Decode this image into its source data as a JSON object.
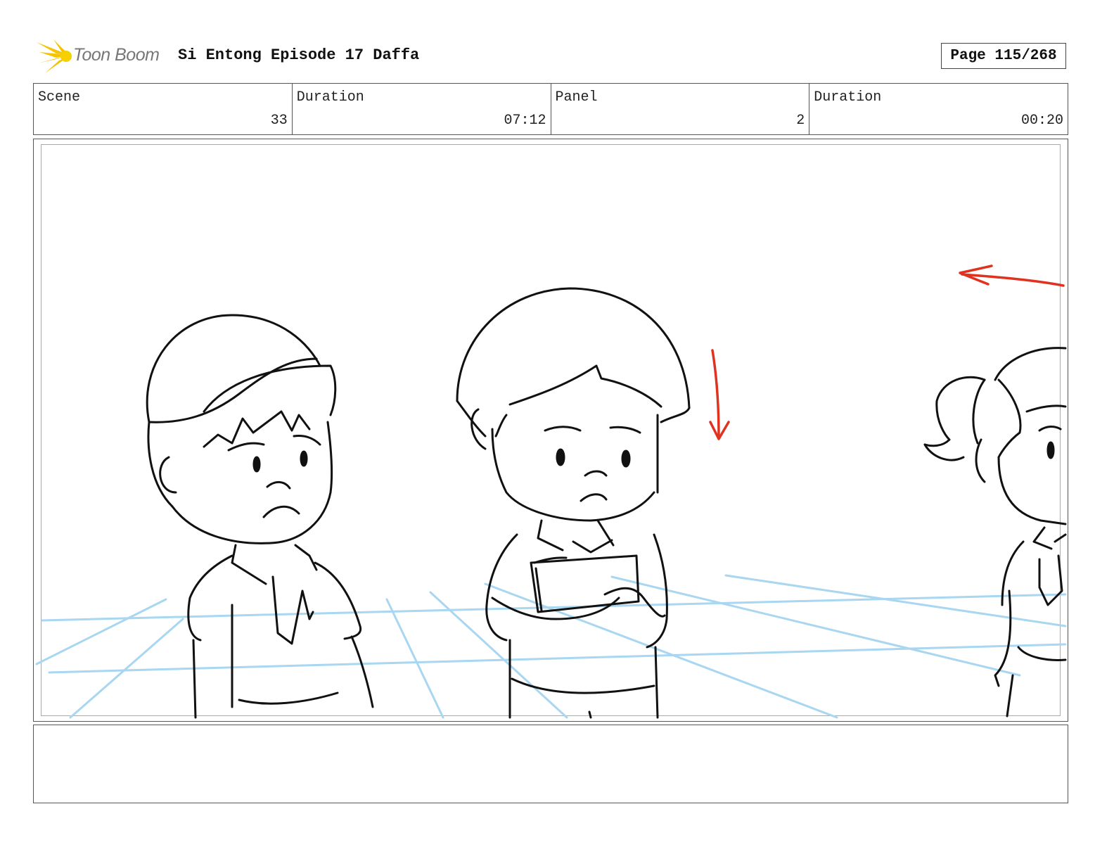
{
  "header": {
    "logo_text": "Toon Boom",
    "project_title": "Si Entong Episode 17 Daffa",
    "page_label": "Page 115/268"
  },
  "info": {
    "scene_label": "Scene",
    "scene_value": "33",
    "scene_duration_label": "Duration",
    "scene_duration_value": "07:12",
    "panel_label": "Panel",
    "panel_value": "2",
    "panel_duration_label": "Duration",
    "panel_duration_value": "00:20"
  },
  "panel": {
    "description": "",
    "colors": {
      "ink": "#111111",
      "guide": "#a9d6f0",
      "arrow": "#e0321e",
      "logo_flame": "#f5c400"
    }
  }
}
